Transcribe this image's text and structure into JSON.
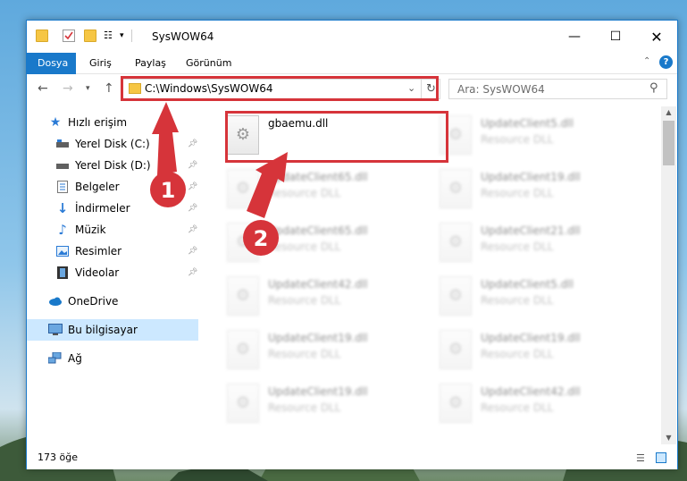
{
  "window": {
    "title": "SysWOW64"
  },
  "ribbon": {
    "tabs": [
      "Dosya",
      "Giriş",
      "Paylaş",
      "Görünüm"
    ]
  },
  "address": {
    "path": "C:\\Windows\\SysWOW64",
    "search_placeholder": "Ara: SysWOW64"
  },
  "nav": {
    "quick_access": "Hızlı erişim",
    "items": [
      {
        "label": "Yerel Disk (C:)",
        "pinned": true
      },
      {
        "label": "Yerel Disk (D:)",
        "pinned": true
      },
      {
        "label": "Belgeler",
        "pinned": true
      },
      {
        "label": "İndirmeler",
        "pinned": true
      },
      {
        "label": "Müzik",
        "pinned": true
      },
      {
        "label": "Resimler",
        "pinned": true
      },
      {
        "label": "Videolar",
        "pinned": true
      }
    ],
    "onedrive": "OneDrive",
    "this_pc": "Bu bilgisayar",
    "network": "Ağ"
  },
  "files": [
    {
      "name": "gbaemu.dll",
      "type": ""
    },
    {
      "name": "UpdateClient5.dll",
      "type": "Resource DLL"
    },
    {
      "name": "UpdateClient65.dll",
      "type": "Resource DLL"
    },
    {
      "name": "UpdateClient19.dll",
      "type": "Resource DLL"
    },
    {
      "name": "UpdateClient65.dll",
      "type": "Resource DLL"
    },
    {
      "name": "UpdateClient21.dll",
      "type": "Resource DLL"
    },
    {
      "name": "UpdateClient42.dll",
      "type": "Resource DLL"
    },
    {
      "name": "UpdateClient5.dll",
      "type": "Resource DLL"
    },
    {
      "name": "UpdateClient19.dll",
      "type": "Resource DLL"
    },
    {
      "name": "UpdateClient19.dll",
      "type": "Resource DLL"
    },
    {
      "name": "UpdateClient19.dll",
      "type": "Resource DLL"
    },
    {
      "name": "UpdateClient42.dll",
      "type": "Resource DLL"
    }
  ],
  "status": {
    "count": "173 öğe"
  },
  "annotations": {
    "step1": "1",
    "step2": "2",
    "color": "#d6343a"
  }
}
